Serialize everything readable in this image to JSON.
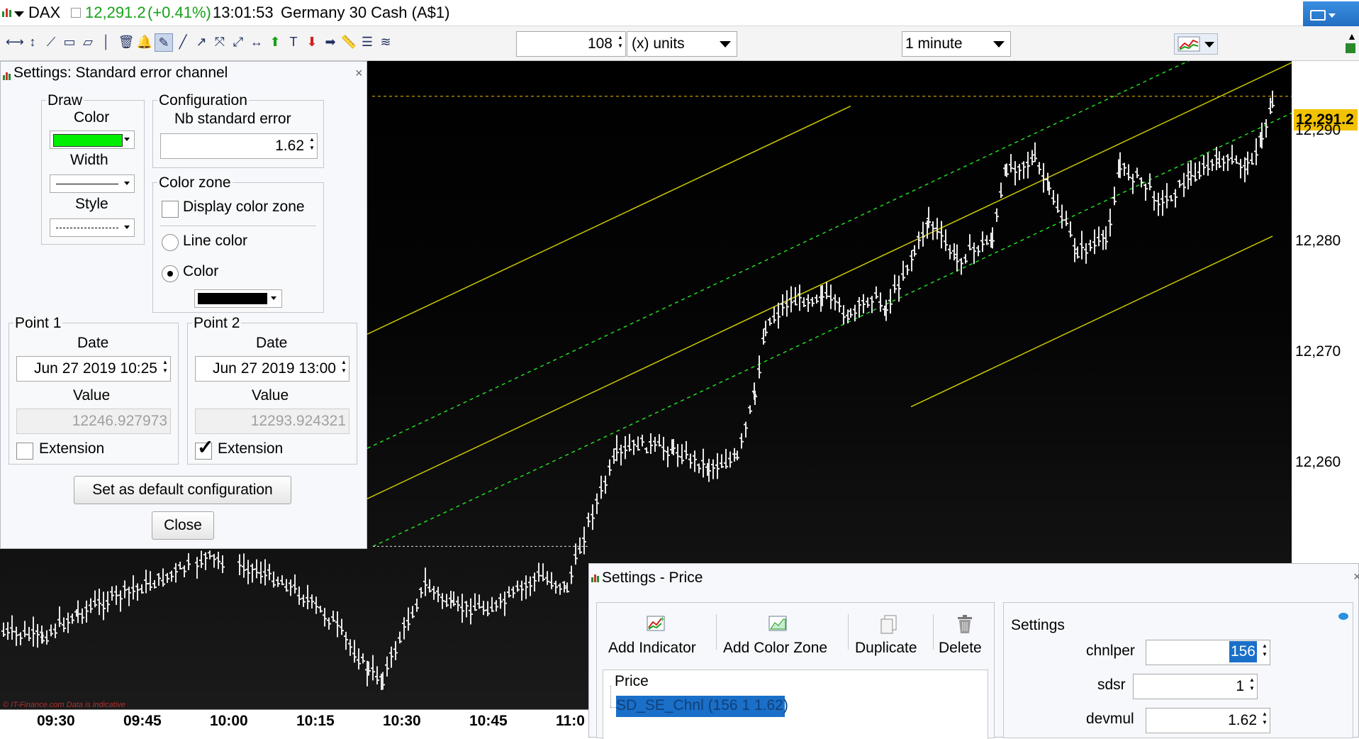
{
  "title_bar": {
    "symbol": "DAX",
    "price": "12,291.2",
    "change": "(+0.41%)",
    "time": "13:01:53",
    "instrument": "Germany 30 Cash (A$1)"
  },
  "toolbar": {
    "units_value": "108",
    "units_label": "(x) units",
    "interval": "1 minute"
  },
  "chart": {
    "price_tag": "12,291.2",
    "y_ticks": [
      {
        "label": "12,290",
        "value": 12290
      },
      {
        "label": "12,280",
        "value": 12280
      },
      {
        "label": "12,270",
        "value": 12270
      },
      {
        "label": "12,260",
        "value": 12260
      }
    ],
    "x_ticks": [
      "09:30",
      "09:45",
      "10:00",
      "10:15",
      "10:30",
      "10:45",
      "11:0"
    ],
    "watermark": "© IT-Finance.com  Data is indicative",
    "channel": {
      "point1": {
        "time": "Jun 27 2019 10:25",
        "value": 12246.927973
      },
      "point2": {
        "time": "Jun 27 2019 13:00",
        "value": 12293.924321
      },
      "nb_standard_error": 1.62
    }
  },
  "settings_channel": {
    "title": "Settings: Standard error channel",
    "draw_label": "Draw",
    "color_label": "Color",
    "color_value": "#00ee00",
    "width_label": "Width",
    "style_label": "Style",
    "configuration_label": "Configuration",
    "nb_se_label": "Nb standard error",
    "nb_se_value": "1.62",
    "color_zone_label": "Color zone",
    "display_color_zone": "Display color zone",
    "line_color": "Line color",
    "color_option": "Color",
    "zone_color_value": "#000000",
    "point1_label": "Point 1",
    "point2_label": "Point 2",
    "date_label": "Date",
    "value_label": "Value",
    "p1_date": "Jun 27 2019 10:25",
    "p1_value": "12246.927973",
    "p2_date": "Jun 27 2019 13:00",
    "p2_value": "12293.924321",
    "extension_label": "Extension",
    "p1_extension": false,
    "p2_extension": true,
    "default_button": "Set as default configuration",
    "close_button": "Close"
  },
  "settings_price": {
    "title": "Settings - Price",
    "add_indicator": "Add Indicator",
    "add_color_zone": "Add Color Zone",
    "duplicate": "Duplicate",
    "delete": "Delete",
    "tree_root": "Price",
    "tree_child": "SD_SE_Chnl (156 1 1.62)",
    "settings_label": "Settings",
    "params": [
      {
        "name": "chnlper",
        "value": "156"
      },
      {
        "name": "sdsr",
        "value": "1"
      },
      {
        "name": "devmul",
        "value": "1.62"
      }
    ]
  },
  "colors": {
    "accent_green": "#18a018",
    "price_tag_bg": "#f2c200",
    "channel_main": "#c8c800",
    "channel_se": "#22dd22",
    "selection": "#1a6fc8"
  }
}
